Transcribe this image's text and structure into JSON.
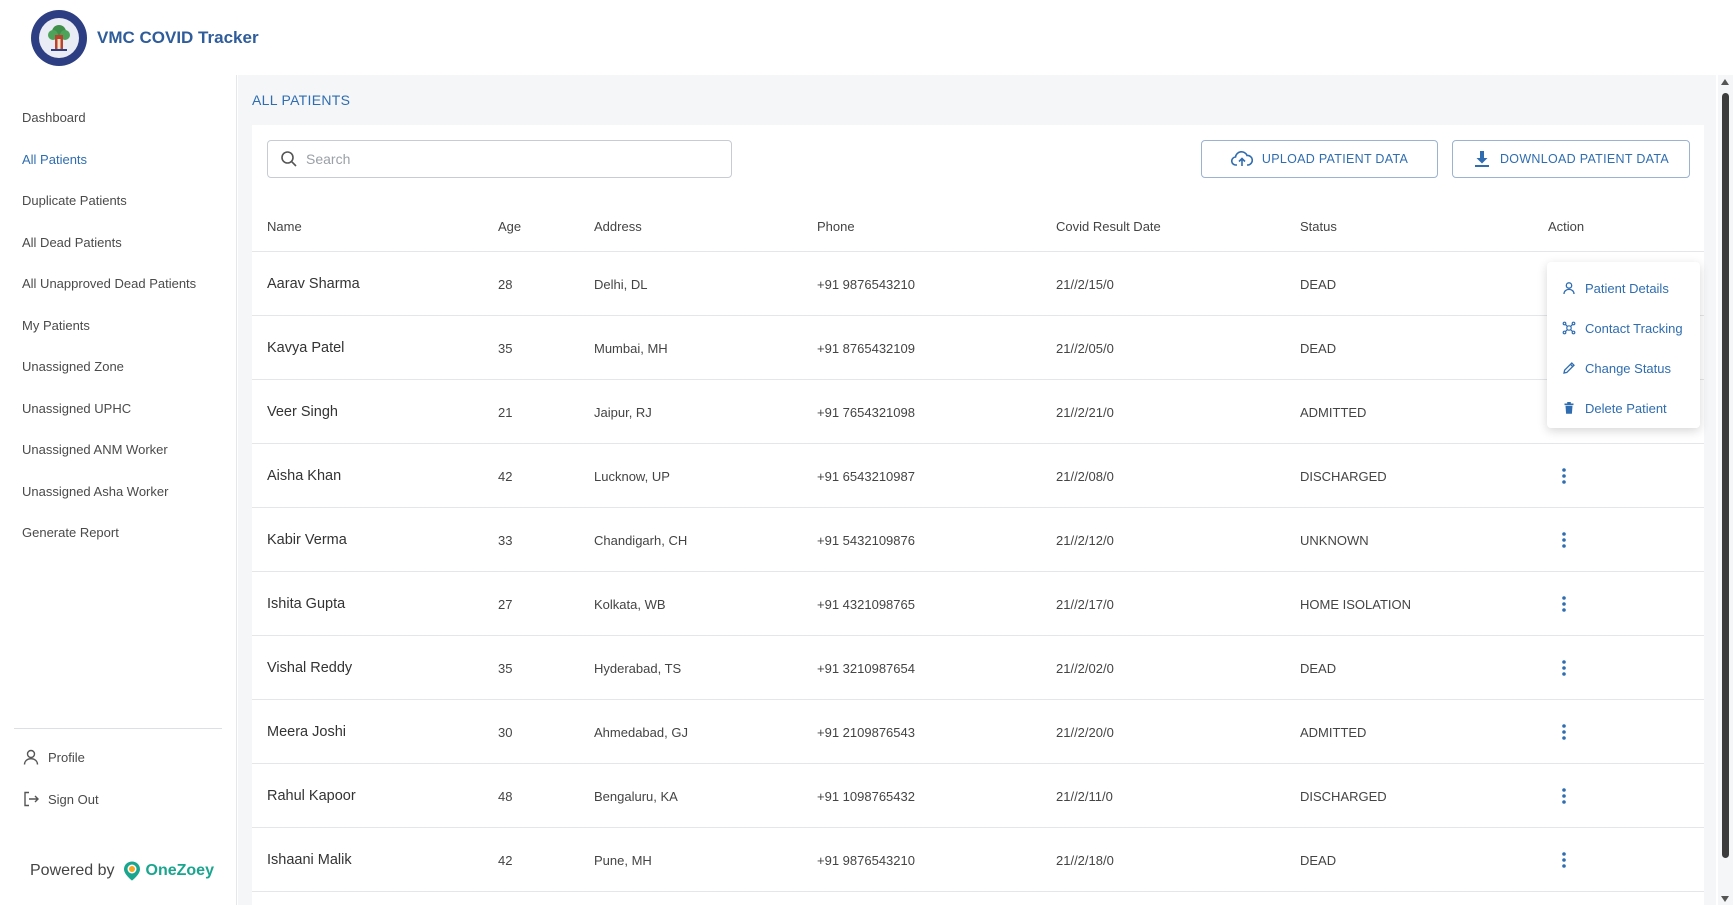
{
  "app": {
    "title": "VMC COVID Tracker"
  },
  "sidebar": {
    "items": [
      {
        "label": "Dashboard",
        "active": false
      },
      {
        "label": "All Patients",
        "active": true
      },
      {
        "label": "Duplicate Patients",
        "active": false
      },
      {
        "label": "All Dead Patients",
        "active": false
      },
      {
        "label": "All Unapproved Dead Patients",
        "active": false
      },
      {
        "label": "My Patients",
        "active": false
      },
      {
        "label": "Unassigned Zone",
        "active": false
      },
      {
        "label": "Unassigned UPHC",
        "active": false
      },
      {
        "label": "Unassigned ANM Worker",
        "active": false
      },
      {
        "label": "Unassigned Asha Worker",
        "active": false
      },
      {
        "label": "Generate Report",
        "active": false
      }
    ],
    "footer": {
      "profile": "Profile",
      "sign_out": "Sign Out"
    },
    "powered_by": "Powered by",
    "brand": "OneZoey"
  },
  "main": {
    "page_title": "ALL PATIENTS",
    "search_placeholder": "Search",
    "upload_label": "UPLOAD PATIENT DATA",
    "download_label": "DOWNLOAD PATIENT DATA"
  },
  "table": {
    "columns": [
      "Name",
      "Age",
      "Address",
      "Phone",
      "Covid Result Date",
      "Status",
      "Action"
    ],
    "rows": [
      {
        "name": "Aarav Sharma",
        "age": "28",
        "address": "Delhi, DL",
        "phone": "+91 9876543210",
        "date": "21//2/15/0",
        "status": "DEAD"
      },
      {
        "name": "Kavya Patel",
        "age": "35",
        "address": "Mumbai, MH",
        "phone": "+91 8765432109",
        "date": "21//2/05/0",
        "status": "DEAD"
      },
      {
        "name": "Veer Singh",
        "age": "21",
        "address": "Jaipur, RJ",
        "phone": "+91 7654321098",
        "date": "21//2/21/0",
        "status": "ADMITTED"
      },
      {
        "name": "Aisha Khan",
        "age": "42",
        "address": "Lucknow, UP",
        "phone": "+91 6543210987",
        "date": "21//2/08/0",
        "status": "DISCHARGED"
      },
      {
        "name": "Kabir Verma",
        "age": "33",
        "address": "Chandigarh, CH",
        "phone": "+91 5432109876",
        "date": "21//2/12/0",
        "status": "UNKNOWN"
      },
      {
        "name": "Ishita Gupta",
        "age": "27",
        "address": "Kolkata, WB",
        "phone": "+91 4321098765",
        "date": "21//2/17/0",
        "status": "HOME ISOLATION"
      },
      {
        "name": "Vishal Reddy",
        "age": "35",
        "address": "Hyderabad, TS",
        "phone": "+91 3210987654",
        "date": "21//2/02/0",
        "status": "DEAD"
      },
      {
        "name": "Meera Joshi",
        "age": "30",
        "address": "Ahmedabad, GJ",
        "phone": "+91 2109876543",
        "date": "21//2/20/0",
        "status": "ADMITTED"
      },
      {
        "name": "Rahul Kapoor",
        "age": "48",
        "address": "Bengaluru, KA",
        "phone": "+91 1098765432",
        "date": "21//2/11/0",
        "status": "DISCHARGED"
      },
      {
        "name": "Ishaani Malik",
        "age": "42",
        "address": "Pune, MH",
        "phone": "+91 9876543210",
        "date": "21//2/18/0",
        "status": "DEAD"
      }
    ]
  },
  "action_menu": {
    "items": [
      {
        "label": "Patient Details",
        "icon": "person-icon"
      },
      {
        "label": "Contact Tracking",
        "icon": "tracking-icon"
      },
      {
        "label": "Change Status",
        "icon": "pencil-icon"
      },
      {
        "label": "Delete Patient",
        "icon": "trash-icon"
      }
    ]
  },
  "colors": {
    "accent": "#2f6db0",
    "brand": "#1aa58f",
    "logo": "#2d3f82"
  }
}
